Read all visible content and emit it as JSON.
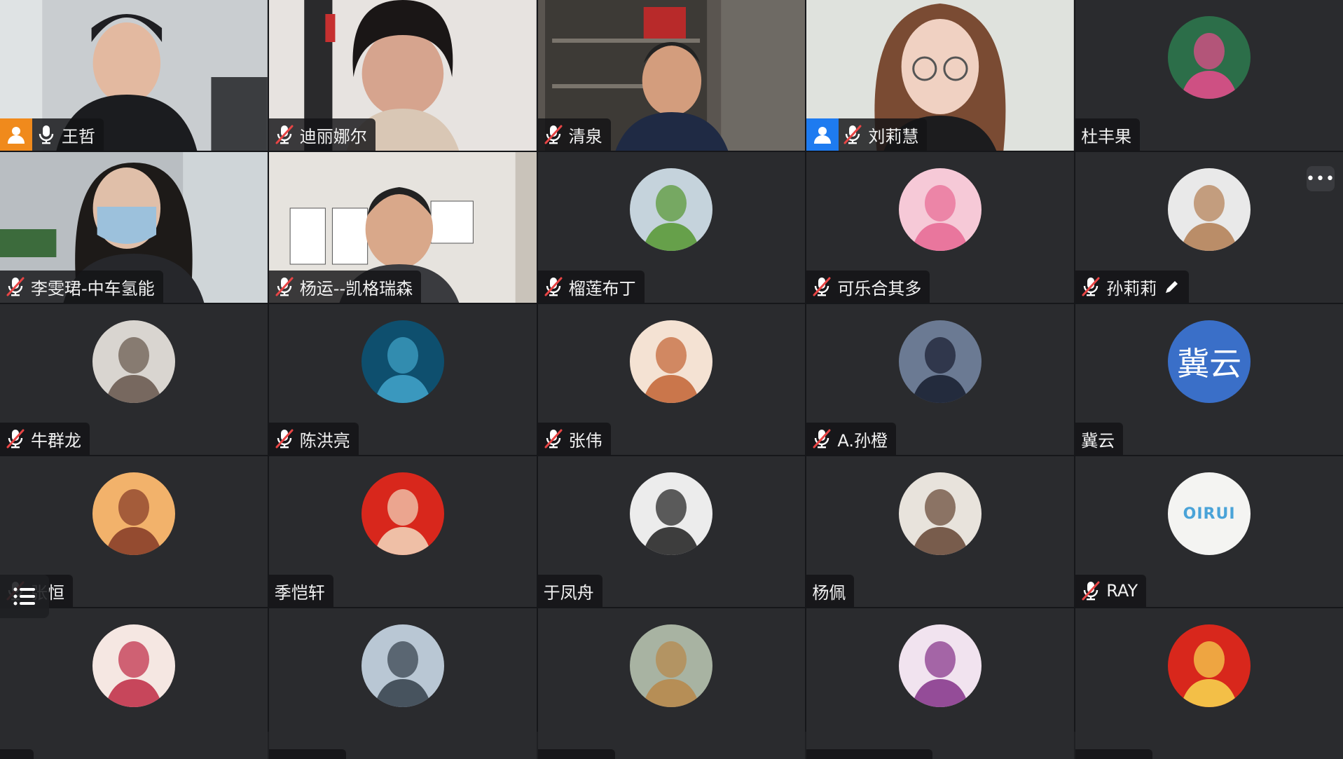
{
  "participants": [
    {
      "name": "王哲",
      "type": "video",
      "scene": "office-man",
      "muted": false,
      "host_badge": "orange"
    },
    {
      "name": "迪丽娜尔",
      "type": "video",
      "scene": "woman-room",
      "muted": true
    },
    {
      "name": "清泉",
      "type": "video",
      "scene": "bookshelf-man",
      "muted": true
    },
    {
      "name": "刘莉慧",
      "type": "video",
      "scene": "glasses-woman",
      "muted": true,
      "host_badge": "blue"
    },
    {
      "name": "杜丰果",
      "type": "avatar",
      "avatar": "flower-art-avatar",
      "muted": null
    },
    {
      "name": "李雯珺-中车氢能",
      "type": "video",
      "scene": "mask-woman",
      "muted": true
    },
    {
      "name": "杨运--凯格瑞森",
      "type": "video",
      "scene": "office-man-2",
      "muted": true
    },
    {
      "name": "榴莲布丁",
      "type": "avatar",
      "avatar": "meadow-avatar",
      "muted": true
    },
    {
      "name": "可乐合其多",
      "type": "avatar",
      "avatar": "pink-plush-avatar",
      "muted": true
    },
    {
      "name": "孙莉莉",
      "type": "avatar",
      "avatar": "portrait-woman-avatar",
      "muted": true,
      "editing": true,
      "more": true
    },
    {
      "name": "牛群龙",
      "type": "avatar",
      "avatar": "selfie-girl-avatar",
      "muted": true
    },
    {
      "name": "陈洪亮",
      "type": "avatar",
      "avatar": "ocean-wave-avatar",
      "muted": true
    },
    {
      "name": "张伟",
      "type": "avatar",
      "avatar": "cat-woman-avatar",
      "muted": true
    },
    {
      "name": "A.孙橙",
      "type": "avatar",
      "avatar": "anime-girl-avatar",
      "muted": true
    },
    {
      "name": "冀云",
      "type": "avatar",
      "avatar": "text-avatar",
      "avatar_text": "冀云",
      "muted": null
    },
    {
      "name": "张恒",
      "type": "avatar",
      "avatar": "cartoon-palace-avatar",
      "muted": true
    },
    {
      "name": "季恺轩",
      "type": "avatar",
      "avatar": "flag-couple-avatar",
      "muted": null
    },
    {
      "name": "于凤舟",
      "type": "avatar",
      "avatar": "suit-man-avatar",
      "muted": null
    },
    {
      "name": "杨佩",
      "type": "avatar",
      "avatar": "child-avatar",
      "muted": null
    },
    {
      "name": "RAY",
      "type": "avatar",
      "avatar": "logo-avatar",
      "avatar_text": "OIRUI",
      "muted": true
    },
    {
      "name": "",
      "type": "avatar",
      "avatar": "cartoon-girl-avatar",
      "partial": true
    },
    {
      "name": "",
      "type": "avatar",
      "avatar": "fighter-jet-avatar",
      "partial": true
    },
    {
      "name": "",
      "type": "avatar",
      "avatar": "dog-outdoor-avatar",
      "partial": true
    },
    {
      "name": "",
      "type": "avatar",
      "avatar": "cartoon-purple-avatar",
      "partial": true
    },
    {
      "name": "",
      "type": "avatar",
      "avatar": "flag-sunglasses-avatar",
      "partial": true
    }
  ],
  "controls": {
    "more_label": "•••",
    "list_toggle_icon": "participant-list-icon"
  },
  "colors": {
    "tile_bg": "#2a2b2e",
    "badge_orange": "#f08a1c",
    "badge_blue": "#1e7bf0",
    "muted_red": "#e84545"
  }
}
